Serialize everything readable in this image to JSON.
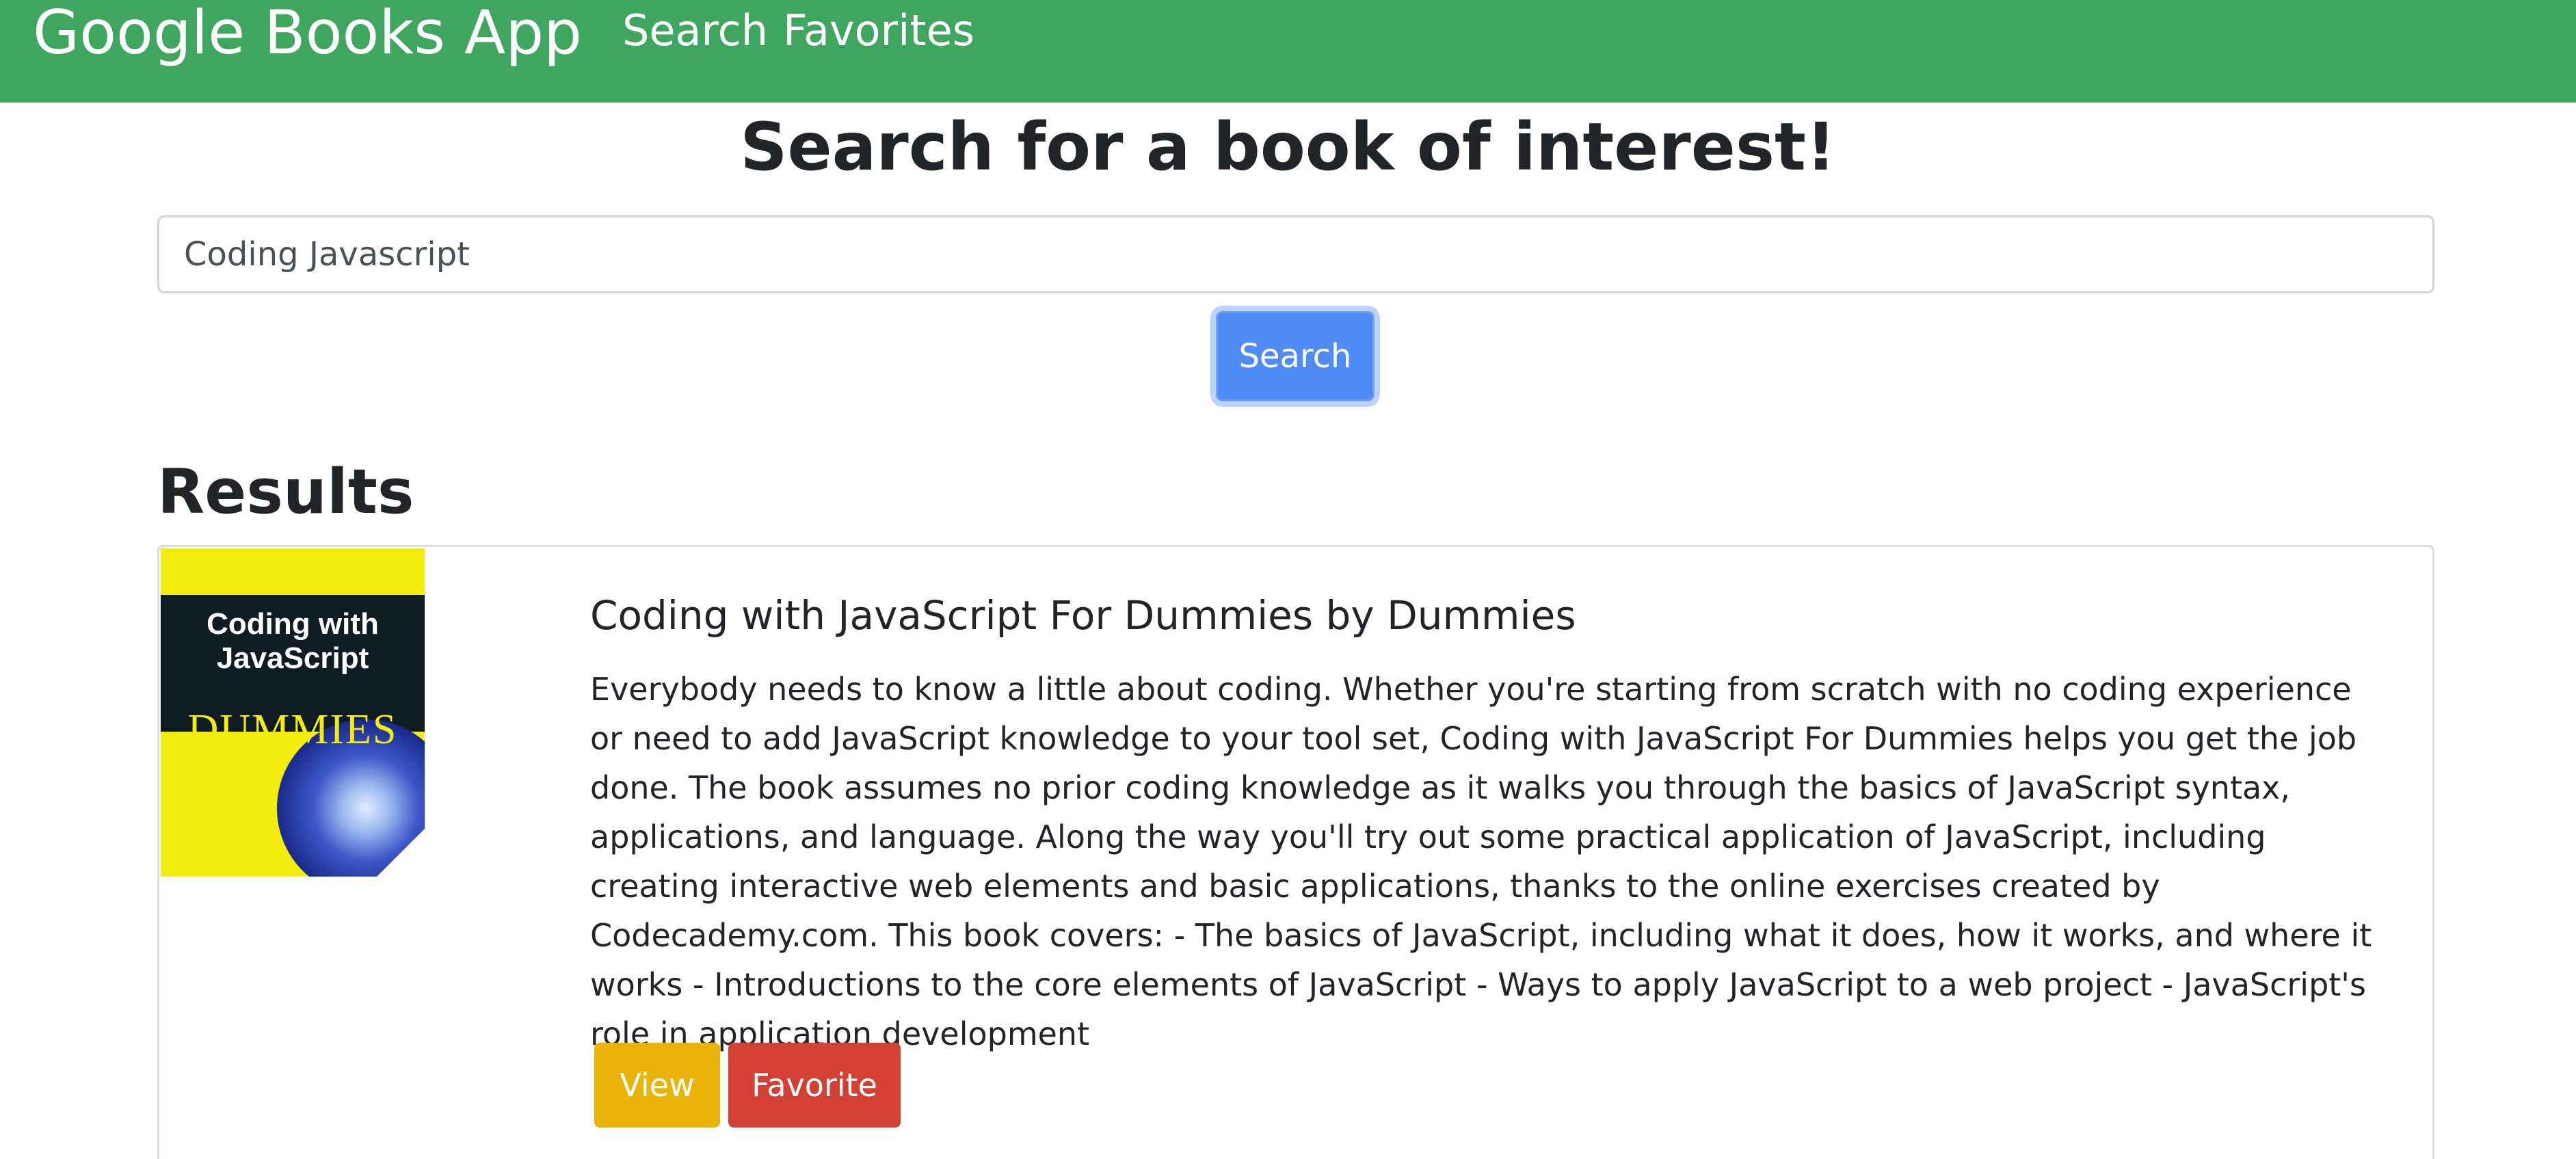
{
  "navbar": {
    "brand": "Google Books App",
    "links": [
      "Search",
      "Favorites"
    ]
  },
  "page": {
    "title": "Search for a book of interest!"
  },
  "search": {
    "value": "Coding Javascript",
    "button_label": "Search"
  },
  "results": {
    "heading": "Results",
    "items": [
      {
        "title": "Coding with JavaScript For Dummies by Dummies",
        "description": "Everybody needs to know a little about coding. Whether you're starting from scratch with no coding experience or need to add JavaScript knowledge to your tool set, Coding with JavaScript For Dummies helps you get the job done. The book assumes no prior coding knowledge as it walks you through the basics of JavaScript syntax, applications, and language. Along the way you'll try out some practical application of JavaScript, including creating interactive web elements and basic applications, thanks to the online exercises created by Codecademy.com. This book covers: - The basics of JavaScript, including what it does, how it works, and where it works - Introductions to the core elements of JavaScript - Ways to apply JavaScript to a web project - JavaScript's role in application development",
        "view_label": "View",
        "favorite_label": "Favorite",
        "cover": {
          "title": "Coding with JavaScript",
          "brand": "DUMMIES"
        }
      }
    ]
  },
  "colors": {
    "navbar": "#3fa660",
    "primary": "#4f8cf7",
    "warning": "#eab308",
    "danger": "#d44134"
  }
}
